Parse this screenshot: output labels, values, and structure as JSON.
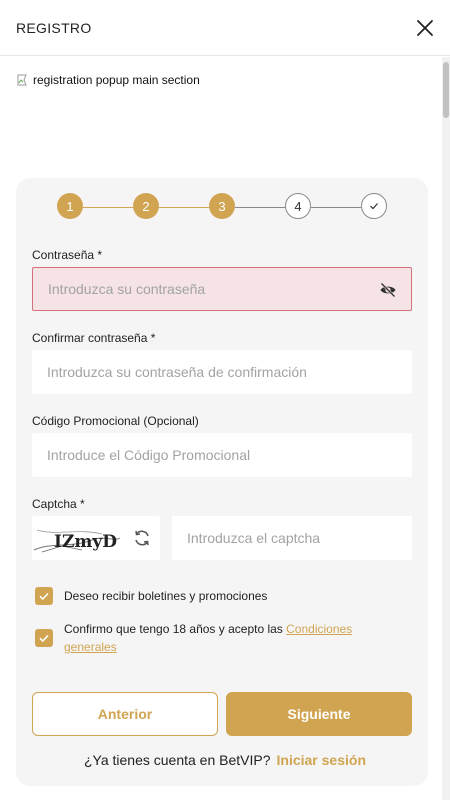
{
  "header": {
    "title": "REGISTRO"
  },
  "banner": {
    "alt": "registration popup main section"
  },
  "stepper": {
    "steps": [
      "1",
      "2",
      "3",
      "4"
    ],
    "current": 3,
    "total": 5
  },
  "password": {
    "label": "Contraseña *",
    "placeholder": "Introduzca su contraseña"
  },
  "confirm": {
    "label": "Confirmar contraseña *",
    "placeholder": "Introduzca su contraseña de confirmación"
  },
  "promo": {
    "label": "Código Promocional (Opcional)",
    "placeholder": "Introduce el Código Promocional"
  },
  "captcha": {
    "label": "Captcha *",
    "code": "IZmyD",
    "placeholder": "Introduzca el captcha"
  },
  "checkboxes": {
    "newsletter": {
      "text": "Deseo recibir boletines y promociones",
      "checked": true
    },
    "terms": {
      "text": "Confirmo que tengo 18 años y acepto las ",
      "link_line1": "Condiciones",
      "link_line2": "generales",
      "checked": true
    }
  },
  "buttons": {
    "prev": "Anterior",
    "next": "Siguiente"
  },
  "footer": {
    "question": "¿Ya tienes cuenta en BetVIP?",
    "login": "Iniciar sesión"
  },
  "colors": {
    "accent": "#d1a452",
    "error_bg": "#f5e3e5",
    "error_border": "#d6707d",
    "card_bg": "#f5f5f5"
  }
}
